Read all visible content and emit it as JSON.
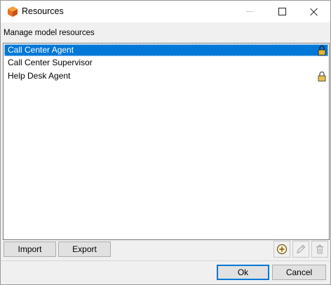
{
  "window": {
    "title": "Resources",
    "icon": "cube-logo-icon"
  },
  "header": {
    "subtitle": "Manage model resources"
  },
  "resources": {
    "items": [
      {
        "label": "Call Center Agent",
        "selected": true,
        "locked": true
      },
      {
        "label": "Call Center Supervisor",
        "selected": false,
        "locked": false
      },
      {
        "label": "Help Desk Agent",
        "selected": false,
        "locked": true
      }
    ]
  },
  "toolbar": {
    "import_label": "Import",
    "export_label": "Export",
    "add_icon": "add-circle-icon",
    "edit_icon": "pencil-icon",
    "delete_icon": "trash-icon"
  },
  "footer": {
    "ok_label": "Ok",
    "cancel_label": "Cancel"
  },
  "colors": {
    "selection": "#0078d7",
    "lock": "#c9a227"
  }
}
